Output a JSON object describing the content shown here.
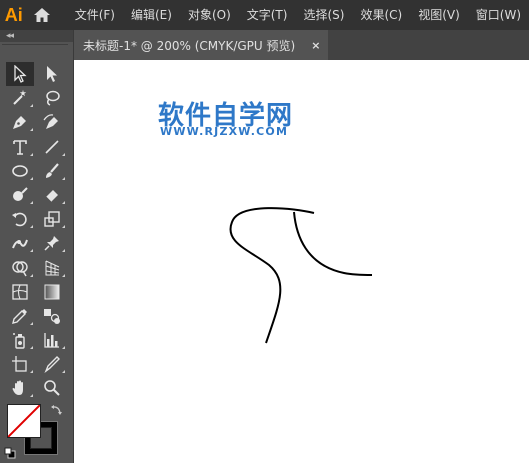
{
  "app": {
    "logo_text": "Ai"
  },
  "menu": {
    "items": [
      "文件(F)",
      "编辑(E)",
      "对象(O)",
      "文字(T)",
      "选择(S)",
      "效果(C)",
      "视图(V)",
      "窗口(W)"
    ]
  },
  "toolbar": {
    "collapse_glyph": "◂◂",
    "tools": [
      "selection-tool",
      "direct-selection-tool",
      "magic-wand-tool",
      "lasso-tool",
      "pen-tool",
      "curvature-tool",
      "type-tool",
      "line-segment-tool",
      "ellipse-tool",
      "paintbrush-tool",
      "blob-brush-tool",
      "eraser-tool",
      "rotate-tool",
      "scale-tool",
      "width-tool",
      "puppet-warp-tool",
      "shape-builder-tool",
      "perspective-grid-tool",
      "mesh-tool",
      "gradient-tool",
      "eyedropper-tool",
      "blend-tool",
      "symbol-sprayer-tool",
      "column-graph-tool",
      "artboard-tool",
      "slice-tool",
      "hand-tool",
      "zoom-tool"
    ],
    "selected_tool": "selection-tool",
    "fill_color": "#ffffff",
    "stroke_color": "#000000"
  },
  "document": {
    "tab_title": "未标题-1* @ 200% (CMYK/GPU 预览)",
    "close_glyph": "×"
  },
  "canvas": {
    "watermark_title": "软件自学网",
    "watermark_url": "WWW.RJZXW.COM",
    "watermark_color": "#2e78c8"
  },
  "colors": {
    "menubar_bg": "#323232",
    "panel_bg": "#535353",
    "logo": "#ff9a00"
  }
}
